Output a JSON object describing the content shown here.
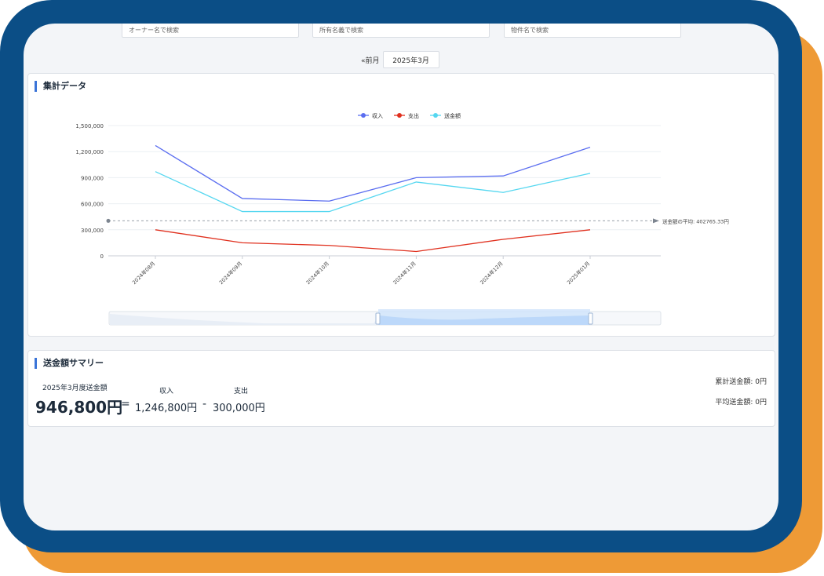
{
  "search": {
    "owner_placeholder": "オーナー名で検索",
    "holder_placeholder": "所有名義で検索",
    "property_placeholder": "物件名で検索"
  },
  "month_nav": {
    "prev_label": "«前月",
    "current_month": "2025年3月"
  },
  "summary_card": {
    "title": "集計データ"
  },
  "chart_data": {
    "type": "line",
    "categories": [
      "2024年08月",
      "2024年09月",
      "2024年10月",
      "2024年11月",
      "2024年12月",
      "2025年01月"
    ],
    "series": [
      {
        "name": "収入",
        "color": "#5b6ef0",
        "values": [
          1270000,
          660000,
          630000,
          900000,
          920000,
          1250000
        ]
      },
      {
        "name": "支出",
        "color": "#e0301e",
        "values": [
          300000,
          150000,
          120000,
          50000,
          190000,
          300000
        ]
      },
      {
        "name": "送金額",
        "color": "#55d7f0",
        "values": [
          970000,
          510000,
          510000,
          850000,
          730000,
          950000
        ]
      }
    ],
    "y_ticks": [
      "1,500,000",
      "1,200,000",
      "900,000",
      "600,000",
      "300,000",
      "0"
    ],
    "ylim": [
      0,
      1500000
    ],
    "average_line": {
      "value": 402765.33,
      "label": "送金額の平均: 402765.33円"
    },
    "legend_position": "top-center",
    "grid": true
  },
  "transfer_summary": {
    "title": "送金額サマリー",
    "month_label": "2025年3月度送金額",
    "amount": "946,800円",
    "equals": "=",
    "income_label": "収入",
    "income": "1,246,800円",
    "minus": "-",
    "expense_label": "支出",
    "expense": "300,000円",
    "cumulative": "累計送金額: 0円",
    "average": "平均送金額: 0円"
  },
  "colors": {
    "frame_navy": "#0b4e86",
    "frame_orange": "#ee9a36",
    "accent": "#3b74d8"
  }
}
